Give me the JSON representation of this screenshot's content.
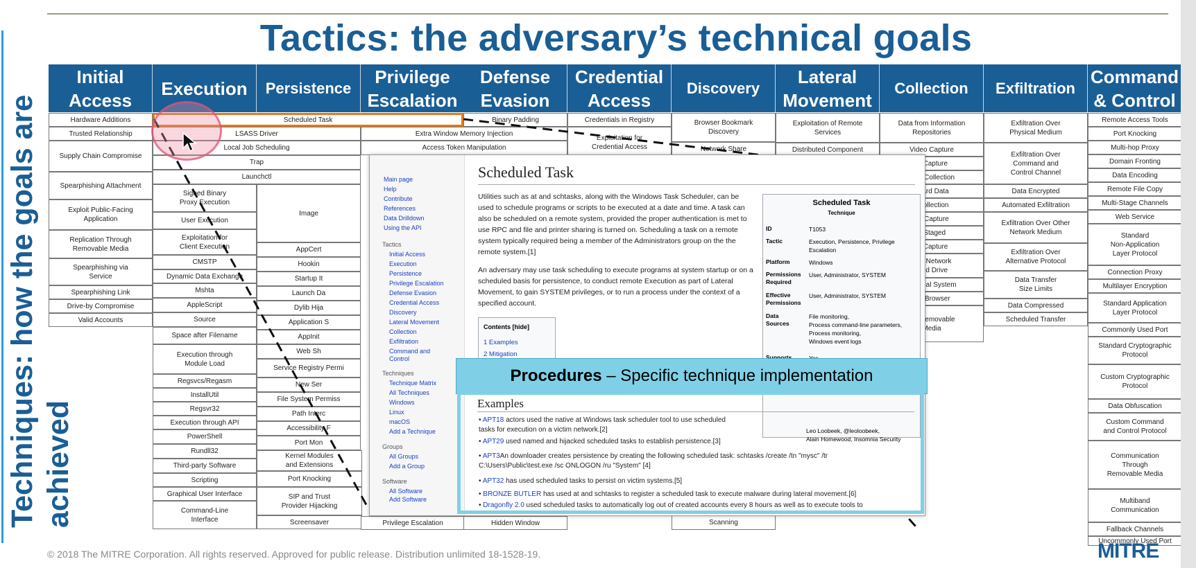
{
  "title": "Tactics: the adversary’s technical goals",
  "side_text": {
    "line1": "Techniques: how the goals are",
    "line2": "achieved"
  },
  "tactics": [
    "Initial\nAccess",
    "Execution",
    "Persistence",
    "Privilege\nEscalation",
    "Defense\nEvasion",
    "Credential\nAccess",
    "Discovery",
    "Lateral\nMovement",
    "Collection",
    "Exfiltration",
    "Command\n& Control"
  ],
  "cells": {
    "initial_access": [
      "Hardware Additions",
      "Trusted Relationship",
      "Supply Chain Compromise",
      "Spearphishing Attachment",
      "Exploit Public-Facing\nApplication",
      "Replication Through\nRemovable Media",
      "Spearphishing via\nService",
      "Spearphishing Link",
      "Drive-by Compromise",
      "Valid Accounts"
    ],
    "spanning": [
      "Scheduled Task",
      "LSASS Driver",
      "Local Job Scheduling",
      "Trap",
      "Launchctl"
    ],
    "execution": [
      "Signed Binary\nProxy Execution",
      "User Execution",
      "Exploitation for\nClient Execution",
      "CMSTP",
      "Dynamic Data Exchange",
      "Mshta",
      "AppleScript",
      "Source",
      "Space after Filename",
      "Execution through\nModule Load",
      "Regsvcs/Regasm",
      "InstallUtil",
      "Regsvr32",
      "Execution through API",
      "PowerShell",
      "Rundll32",
      "Third-party Software",
      "Scripting",
      "Graphical User Interface",
      "Command-Line\nInterface"
    ],
    "persistence": [
      "Image",
      "AppCert",
      "Hookin",
      "Startup It",
      "Launch Da",
      "Dylib Hija",
      "Application S",
      "AppInit",
      "Web Sh",
      "Service Registry Permi",
      "New Ser",
      "File System Permiss",
      "Path Interc",
      "Accessibility F",
      "Port Mon",
      "Kernel Modules\nand Extensions",
      "Port Knocking",
      "SIP and Trust\nProvider Hijacking",
      "Screensaver"
    ],
    "privesc_bottom": "Privilege Escalation",
    "defense_evasion": [
      "Binary Padding",
      "Extra Window Memory Injection",
      "Access Token Manipulation",
      "Hidden Window"
    ],
    "credential_access": [
      "Credentials in Registry",
      "Exploitation for\nCredential Access"
    ],
    "discovery": [
      "Browser Bookmark\nDiscovery",
      "Network Share",
      "Scanning"
    ],
    "lateral_movement": [
      "Exploitation of Remote\nServices",
      "Distributed Component"
    ],
    "collection": [
      "Data from Information\nRepositories",
      "Video Capture",
      "io Capture",
      "ated Collection",
      "board Data",
      "l Collection",
      "en Capture",
      "a Staged",
      "ut Capture",
      "rom Network\nared Drive",
      "m Local System",
      "the Browser",
      "om Removable\nMedia"
    ],
    "exfiltration": [
      "Exfiltration Over\nPhysical Medium",
      "Exfiltration Over\nCommand and\nControl Channel",
      "Data Encrypted",
      "Automated Exfiltration",
      "Exfiltration Over Other\nNetwork Medium",
      "Exfiltration Over\nAlternative Protocol",
      "Data Transfer\nSize Limits",
      "Data Compressed",
      "Scheduled Transfer"
    ],
    "command_control": [
      "Remote Access Tools",
      "Port Knocking",
      "Multi-hop Proxy",
      "Domain Fronting",
      "Data Encoding",
      "Remote File Copy",
      "Multi-Stage Channels",
      "Web Service",
      "Standard\nNon-Application\nLayer Protocol",
      "Connection Proxy",
      "Multilayer Encryption",
      "Standard Application\nLayer Protocol",
      "Commonly Used Port",
      "Standard Cryptographic\nProtocol",
      "Custom Cryptographic\nProtocol",
      "Data Obfuscation",
      "Custom Command\nand Control Protocol",
      "Communication\nThrough\nRemovable Media",
      "Multiband\nCommunication",
      "Fallback Channels",
      "Uncommonly Used Port"
    ]
  },
  "wiki": {
    "sidebar_top": [
      "Main page",
      "Help",
      "Contribute",
      "References",
      "Data Drilldown",
      "Using the API"
    ],
    "tactics_group": "Tactics",
    "tactics_links": [
      "Initial Access",
      "Execution",
      "Persistence",
      "Privilege Escalation",
      "Defense Evasion",
      "Credential Access",
      "Discovery",
      "Lateral Movement",
      "Collection",
      "Exfiltration",
      "Command and\nControl"
    ],
    "techniques_group": "Techniques",
    "techniques_links": [
      "Technique Matrix",
      "All Techniques",
      "Windows",
      "Linux",
      "macOS",
      "Add a Technique"
    ],
    "groups_group": "Groups",
    "groups_links": [
      "All Groups",
      "Add a Group"
    ],
    "software_group": "Software",
    "software_links": [
      "All Software",
      "Add Software"
    ],
    "page_title": "Scheduled Task",
    "para1": "Utilities such as at and schtasks, along with the Windows Task Scheduler, can be used to schedule programs or scripts to be executed at a date and time. A task can also be scheduled on a remote system, provided the proper authentication is met to use RPC and file and printer sharing is turned on. Scheduling a task on a remote system typically required being a member of the Administrators group on the the remote system.[1]",
    "para2": "An adversary may use task scheduling to execute programs at system startup or on a scheduled basis for persistence, to conduct remote Execution as part of Lateral Movement, to gain SYSTEM privileges, or to run a process under the context of a specified account.",
    "toc_title": "Contents [hide]",
    "toc_items": [
      "1  Examples",
      "2  Mitigation"
    ],
    "infobox": {
      "title": "Scheduled Task",
      "subtitle": "Technique",
      "rows": [
        {
          "k": "ID",
          "v": "T1053"
        },
        {
          "k": "Tactic",
          "v": "Execution, Persistence, Privilege\nEscalation"
        },
        {
          "k": "Platform",
          "v": "Windows"
        },
        {
          "k": "Permissions\nRequired",
          "v": "User, Administrator, SYSTEM"
        },
        {
          "k": "Effective\nPermissions",
          "v": "User, Administrator, SYSTEM"
        },
        {
          "k": "Data\nSources",
          "v": "File monitoring,\nProcess command-line parameters,\nProcess monitoring,\nWindows event logs"
        },
        {
          "k": "Supports",
          "v": "Yes"
        }
      ],
      "contributors": "Leo Loobeek, @leoloobeek,\nAlain Homewood, Insomnia Security"
    },
    "examples_heading": "Examples",
    "examples": [
      {
        "link": "APT18",
        "text": " actors used the native at Windows task scheduler tool to use scheduled\ntasks for execution on a victim network.[2]"
      },
      {
        "link": "APT29",
        "text": " used named and hijacked scheduled tasks to establish persistence.[3]"
      },
      {
        "link": "APT3",
        "text": "An  downloader creates persistence by creating the following scheduled task: schtasks /create /tn \"mysc\" /tr\nC:\\Users\\Public\\test.exe /sc ONLOGON /ru \"System\" [4]"
      },
      {
        "link": "APT32",
        "text": " has used scheduled tasks to persist on victim systems.[5]"
      },
      {
        "link": "BRONZE BUTLER",
        "text": " has used at and schtasks to register a scheduled task to execute malware during lateral movement.[6]"
      },
      {
        "link": "Dragonfly 2.0",
        "text": " used scheduled tasks to automatically log out of created accounts every 8 hours as well as to execute tools to"
      }
    ]
  },
  "procedures_banner": {
    "bold": "Procedures",
    "rest": " – Specific technique implementation"
  },
  "footer": "© 2018 The MITRE Corporation. All rights reserved. Approved for public release. Distribution unlimited 18-1528-19.",
  "logo": "MITRE",
  "colors": {
    "accent": "#1a5e96",
    "highlight": "#e07a1a",
    "procedures": "#7fd0e6"
  }
}
